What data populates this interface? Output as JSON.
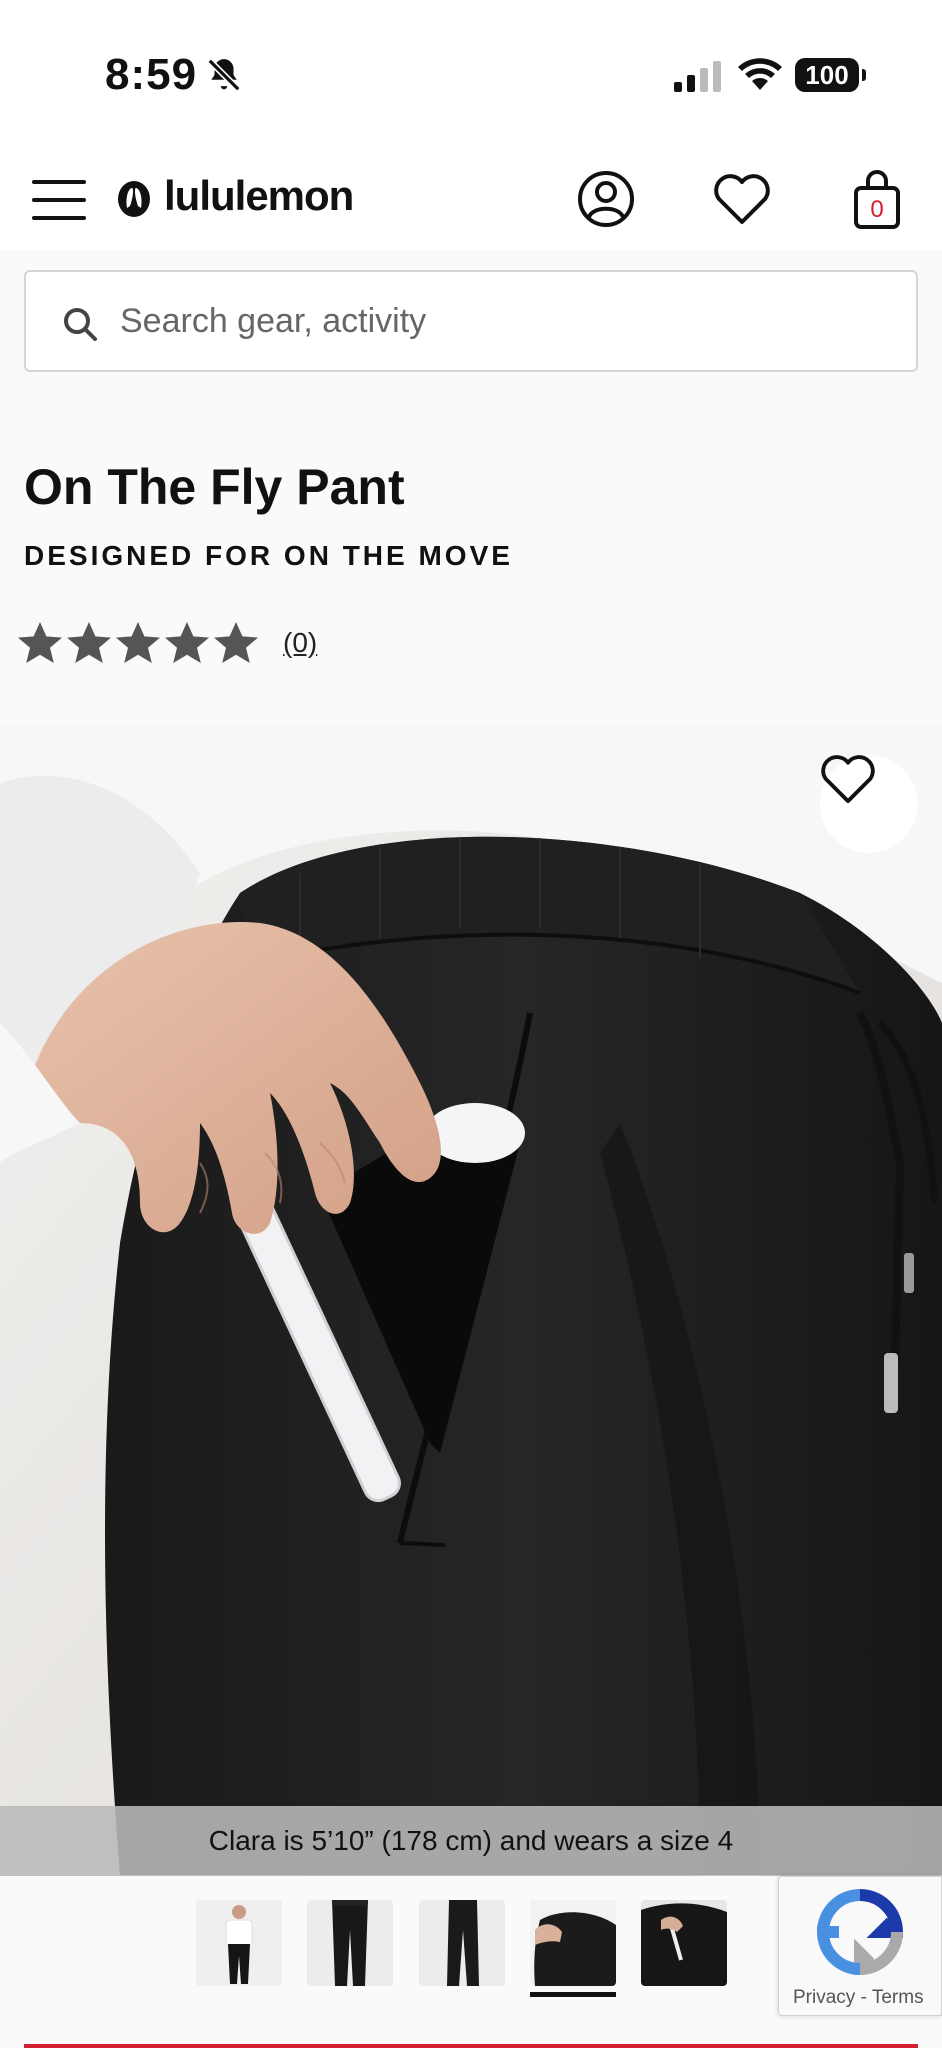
{
  "status_bar": {
    "time": "8:59",
    "battery": "100",
    "icons": [
      "bell-slash-icon",
      "signal-icon",
      "wifi-icon",
      "battery-icon"
    ]
  },
  "header": {
    "brand": "lululemon",
    "bag_count": "0",
    "icons": [
      "menu-icon",
      "lululemon-logo-icon",
      "account-icon",
      "wishlist-icon",
      "shopping-bag-icon"
    ]
  },
  "search": {
    "placeholder": "Search gear, activity"
  },
  "product": {
    "title": "On The Fly Pant",
    "subtitle": "DESIGNED FOR ON THE MOVE",
    "rating": 0,
    "rating_max": 5,
    "review_count": "(0)"
  },
  "gallery": {
    "caption": "Clara is 5’10” (178 cm) and wears a size 4",
    "thumbnail_count": 5,
    "active_thumbnail": 4
  },
  "recaptcha": {
    "privacy": "Privacy",
    "separator": " - ",
    "terms": "Terms"
  },
  "colors": {
    "accent": "#d22030",
    "text": "#111111",
    "star": "#555555",
    "background": "#fafafa"
  }
}
